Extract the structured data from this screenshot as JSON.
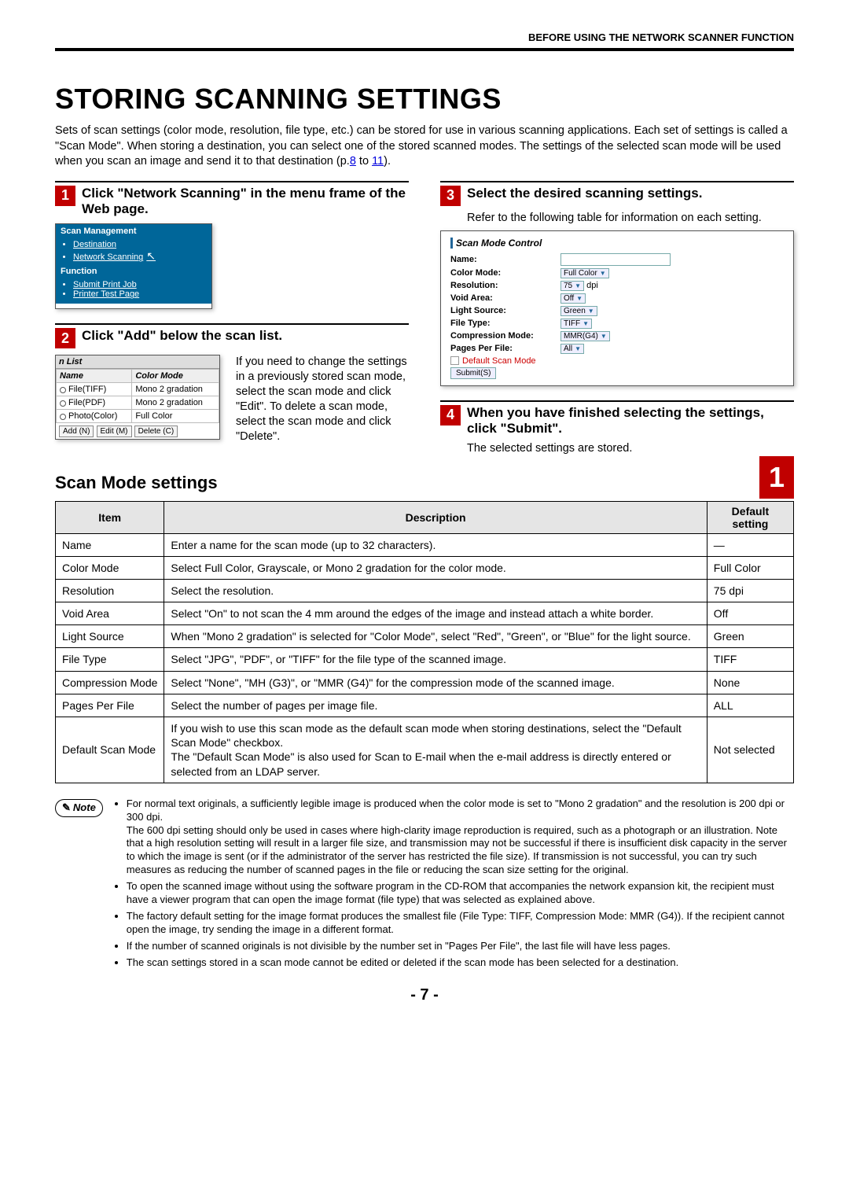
{
  "header": "BEFORE USING THE NETWORK SCANNER FUNCTION",
  "title": "STORING SCANNING SETTINGS",
  "intro_a": "Sets of scan settings (color mode, resolution, file type, etc.) can be stored for use in various scanning applications. Each set of settings is called a \"Scan Mode\". When storing a destination, you can select one of the stored scanned modes. The settings of the selected scan mode will be used when you scan an image and send it to that destination (p.",
  "intro_link1": "8",
  "intro_mid": " to ",
  "intro_link2": "11",
  "intro_end": ").",
  "side_tab": "1",
  "steps": {
    "s1": {
      "num": "1",
      "title": "Click \"Network Scanning\" in the menu frame of the Web page."
    },
    "s2": {
      "num": "2",
      "title": "Click \"Add\" below the scan list.",
      "desc": "If you need to change the settings in a previously stored scan mode, select the scan mode and click \"Edit\". To delete a scan mode, select the scan mode and click \"Delete\"."
    },
    "s3": {
      "num": "3",
      "title": "Select the desired scanning settings.",
      "desc": "Refer to the following table for information on each setting."
    },
    "s4": {
      "num": "4",
      "title": "When you have finished selecting the settings, click \"Submit\".",
      "desc": "The selected settings are stored."
    }
  },
  "mock_sidebar": {
    "h1": "Scan Management",
    "i1": "Destination",
    "i2": "Network Scanning",
    "h2": "Function",
    "i3": "Submit Print Job",
    "i4": "Printer Test Page"
  },
  "mock_list": {
    "cap": "n List",
    "th1": "Name",
    "th2": "Color Mode",
    "r": [
      {
        "n": "File(TIFF)",
        "c": "Mono 2 gradation"
      },
      {
        "n": "File(PDF)",
        "c": "Mono 2 gradation"
      },
      {
        "n": "Photo(Color)",
        "c": "Full Color"
      }
    ],
    "b1": "Add (N)",
    "b2": "Edit (M)",
    "b3": "Delete (C)"
  },
  "mock_ctrl": {
    "cap": "Scan Mode Control",
    "rows": [
      {
        "l": "Name:",
        "v": ""
      },
      {
        "l": "Color Mode:",
        "v": "Full Color"
      },
      {
        "l": "Resolution:",
        "v": "75",
        "suffix": "dpi"
      },
      {
        "l": "Void Area:",
        "v": "Off"
      },
      {
        "l": "Light Source:",
        "v": "Green"
      },
      {
        "l": "File Type:",
        "v": "TIFF"
      },
      {
        "l": "Compression Mode:",
        "v": "MMR(G4)"
      },
      {
        "l": "Pages Per File:",
        "v": "All"
      }
    ],
    "chk": "Default Scan Mode",
    "submit": "Submit(S)"
  },
  "section_h": "Scan Mode settings",
  "table_head": {
    "item": "Item",
    "desc": "Description",
    "def": "Default setting"
  },
  "table_rows": [
    {
      "item": "Name",
      "desc": "Enter a name for the scan mode (up to 32 characters).",
      "def": "—"
    },
    {
      "item": "Color Mode",
      "desc": "Select Full Color, Grayscale, or Mono 2 gradation for the color mode.",
      "def": "Full Color"
    },
    {
      "item": "Resolution",
      "desc": "Select the resolution.",
      "def": "75 dpi"
    },
    {
      "item": "Void Area",
      "desc": "Select \"On\" to not scan the 4 mm around the edges of the image and instead attach a white border.",
      "def": "Off"
    },
    {
      "item": "Light Source",
      "desc": "When \"Mono 2 gradation\" is selected for \"Color Mode\", select \"Red\", \"Green\", or \"Blue\" for the light source.",
      "def": "Green"
    },
    {
      "item": "File Type",
      "desc": "Select \"JPG\", \"PDF\", or \"TIFF\" for the file type of the scanned image.",
      "def": "TIFF"
    },
    {
      "item": "Compression Mode",
      "desc": "Select \"None\", \"MH (G3)\", or \"MMR (G4)\" for the compression mode of the scanned image.",
      "def": "None"
    },
    {
      "item": "Pages Per File",
      "desc": "Select the number of pages per image file.",
      "def": "ALL"
    },
    {
      "item": "Default Scan Mode",
      "desc": "If you wish to use this scan mode as the default scan mode when storing destinations, select the \"Default Scan Mode\" checkbox.\nThe \"Default Scan Mode\" is also used for Scan to E-mail when the e-mail address is directly entered or selected from an LDAP server.",
      "def": "Not selected"
    }
  ],
  "note_label": "Note",
  "notes": [
    "For normal text originals, a sufficiently legible image is produced when the color mode is set to \"Mono 2 gradation\" and the resolution is 200 dpi or 300 dpi.\nThe 600 dpi setting should only be used in cases where high-clarity image reproduction is required, such as a photograph or an illustration. Note that a high resolution setting will result in a larger file size, and transmission may not be successful if there is insufficient disk capacity in the server to which the image is sent (or if the administrator of the server has restricted the file size). If transmission is not successful, you can try such measures as reducing the number of scanned pages in the file or reducing the scan size setting for the original.",
    "To open the scanned image without using the software program in the CD-ROM that accompanies the network expansion kit, the recipient must have a viewer program that can open the image format (file type) that was selected as explained above.",
    "The factory default setting for the image format produces the smallest file (File Type: TIFF, Compression Mode: MMR (G4)). If the recipient cannot open the image, try sending the image in a different format.",
    "If the number of scanned originals is not divisible by the number set in \"Pages Per File\", the last file will have less pages.",
    "The scan settings stored in a scan mode cannot be edited or deleted if the scan mode has been selected for a destination."
  ],
  "page_num": "- 7 -"
}
